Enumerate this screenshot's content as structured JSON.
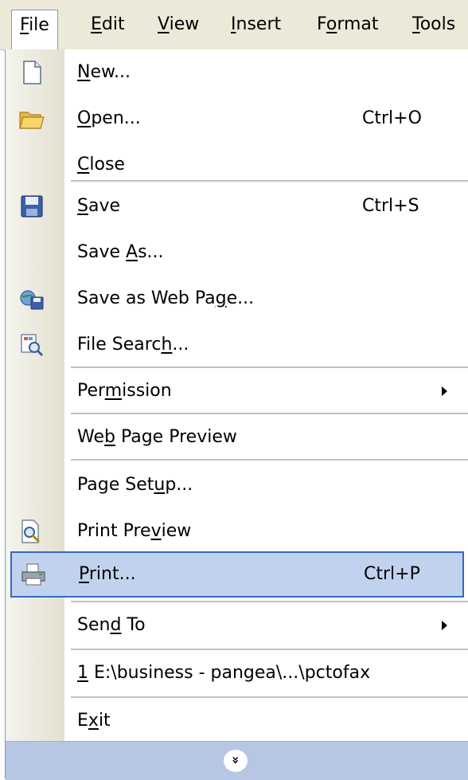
{
  "menubar": {
    "items": [
      {
        "label": "File",
        "access": "F",
        "rest": "ile"
      },
      {
        "label": "Edit",
        "access": "E",
        "rest": "dit"
      },
      {
        "label": "View",
        "access": "V",
        "rest": "iew"
      },
      {
        "label": "Insert",
        "access": "I",
        "rest": "nsert"
      },
      {
        "label": "Format",
        "pre": "F",
        "access": "o",
        "rest": "rmat"
      },
      {
        "label": "Tools",
        "access": "T",
        "rest": "ools"
      }
    ]
  },
  "menu": {
    "items": [
      {
        "pre": "",
        "access": "N",
        "rest": "ew...",
        "shortcut": "",
        "icon": "new-document-icon"
      },
      {
        "pre": "",
        "access": "O",
        "rest": "pen...",
        "shortcut": "Ctrl+O",
        "icon": "open-folder-icon"
      },
      {
        "pre": "",
        "access": "C",
        "rest": "lose",
        "shortcut": "",
        "icon": ""
      },
      {
        "pre": "",
        "access": "S",
        "rest": "ave",
        "shortcut": "Ctrl+S",
        "icon": "save-disk-icon"
      },
      {
        "pre": "Save ",
        "access": "A",
        "rest": "s...",
        "shortcut": "",
        "icon": ""
      },
      {
        "pre": "Save as Web Pa",
        "access": "g",
        "rest": "e...",
        "shortcut": "",
        "icon": "save-web-page-icon"
      },
      {
        "pre": "File Searc",
        "access": "h",
        "rest": "...",
        "shortcut": "",
        "icon": "file-search-icon"
      },
      {
        "pre": "Per",
        "access": "m",
        "rest": "ission",
        "shortcut": "",
        "icon": "",
        "submenu": true
      },
      {
        "pre": "We",
        "access": "b",
        "rest": " Page Preview",
        "shortcut": "",
        "icon": ""
      },
      {
        "pre": "Page Set",
        "access": "u",
        "rest": "p...",
        "shortcut": "",
        "icon": ""
      },
      {
        "pre": "Print Pre",
        "access": "v",
        "rest": "iew",
        "shortcut": "",
        "icon": "print-preview-icon"
      },
      {
        "pre": "",
        "access": "P",
        "rest": "rint...",
        "shortcut": "Ctrl+P",
        "icon": "printer-icon",
        "highlighted": true
      },
      {
        "pre": "Sen",
        "access": "d",
        "rest": " To",
        "shortcut": "",
        "icon": "",
        "submenu": true
      },
      {
        "pre": "",
        "access": "1",
        "rest": " E:\\business - pangea\\...\\pctofax",
        "shortcut": "",
        "icon": ""
      },
      {
        "pre": "E",
        "access": "x",
        "rest": "it",
        "shortcut": "",
        "icon": ""
      }
    ],
    "expand_glyph": "»",
    "colors": {
      "highlight_fill": "#c1d2ee",
      "highlight_border": "#316ac5",
      "expand_bar": "#b6c6e4"
    }
  }
}
